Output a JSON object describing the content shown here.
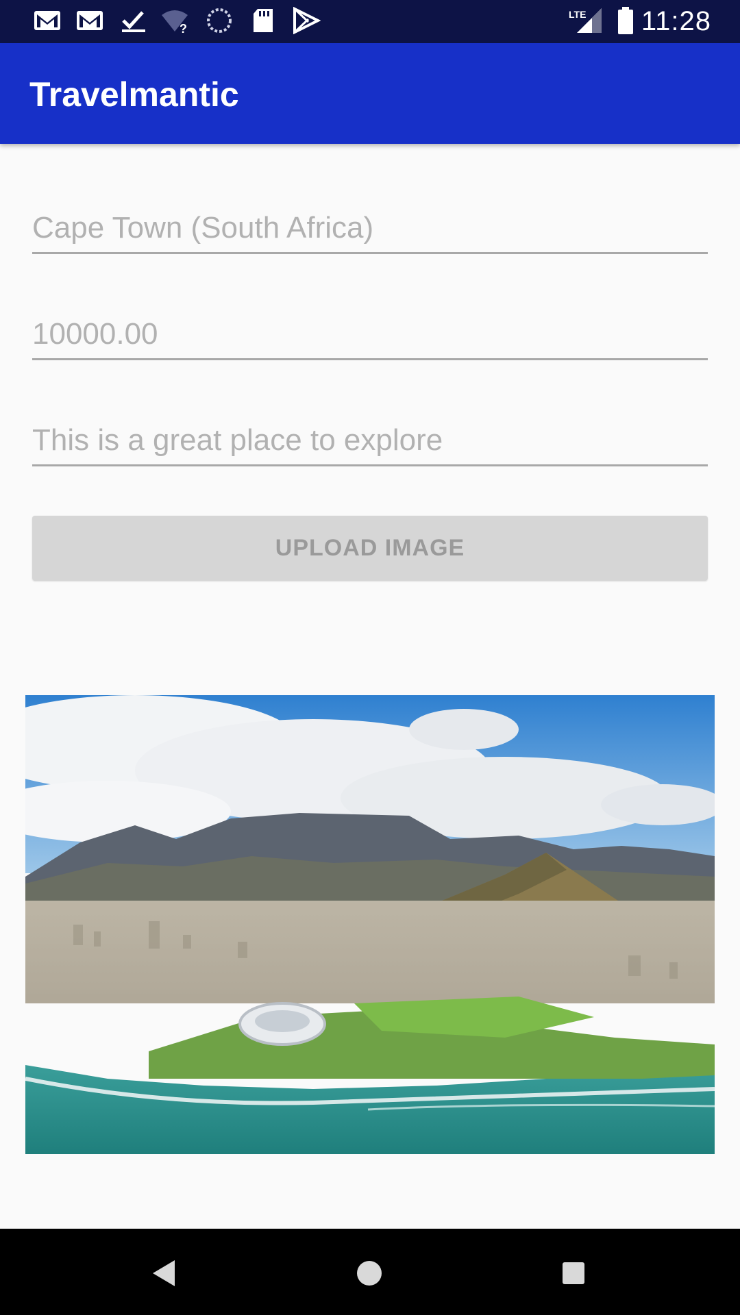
{
  "status_bar": {
    "icons": [
      "gmail-icon",
      "gmail-icon",
      "download-done-icon",
      "wifi-question-icon",
      "sync-icon",
      "sd-card-icon",
      "play-store-icon",
      "lte-signal-icon",
      "battery-icon"
    ],
    "network": "LTE",
    "time": "11:28"
  },
  "app_bar": {
    "title": "Travelmantic"
  },
  "form": {
    "title_placeholder": "Cape Town (South Africa)",
    "price_placeholder": "10000.00",
    "description_placeholder": "This is a great place to explore",
    "upload_button_label": "UPLOAD IMAGE"
  },
  "image": {
    "subject": "aerial-view-cape-town"
  },
  "nav_bar": {
    "buttons": [
      "back-icon",
      "home-icon",
      "recents-icon"
    ]
  },
  "colors": {
    "status_bar": "#0d1346",
    "app_bar": "#1730c8",
    "background": "#fafafa",
    "button_bg": "#d6d6d6",
    "button_text": "#9a9a9a",
    "hint_text": "#b1b1b1"
  }
}
